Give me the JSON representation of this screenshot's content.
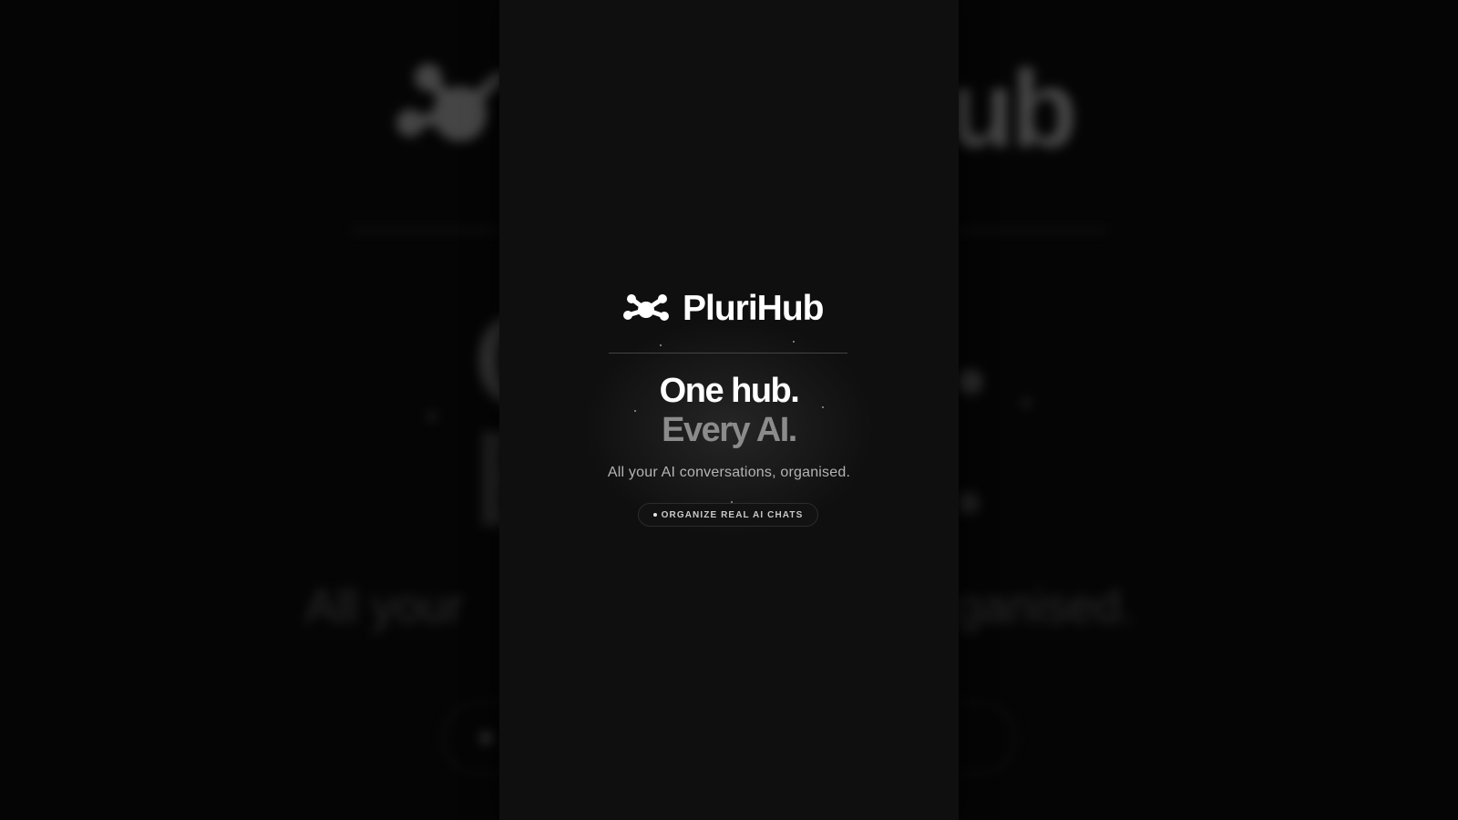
{
  "brand": {
    "name": "PluriHub",
    "logo_icon": "network-nodes-icon"
  },
  "hero": {
    "headline_line1": "One hub.",
    "headline_line2": "Every AI.",
    "tagline": "All your AI conversations, organised.",
    "badge_label": "ORGANIZE REAL AI CHATS"
  },
  "background": {
    "brand_fragment": "ub",
    "tagline_left_fragment": "All your",
    "tagline_right_fragment": "ganised."
  },
  "colors": {
    "background": "#050505",
    "panel": "#0f0f0f",
    "headline_primary": "#ffffff",
    "headline_secondary": "#8b8b8b",
    "tagline": "#b4b4b4"
  }
}
